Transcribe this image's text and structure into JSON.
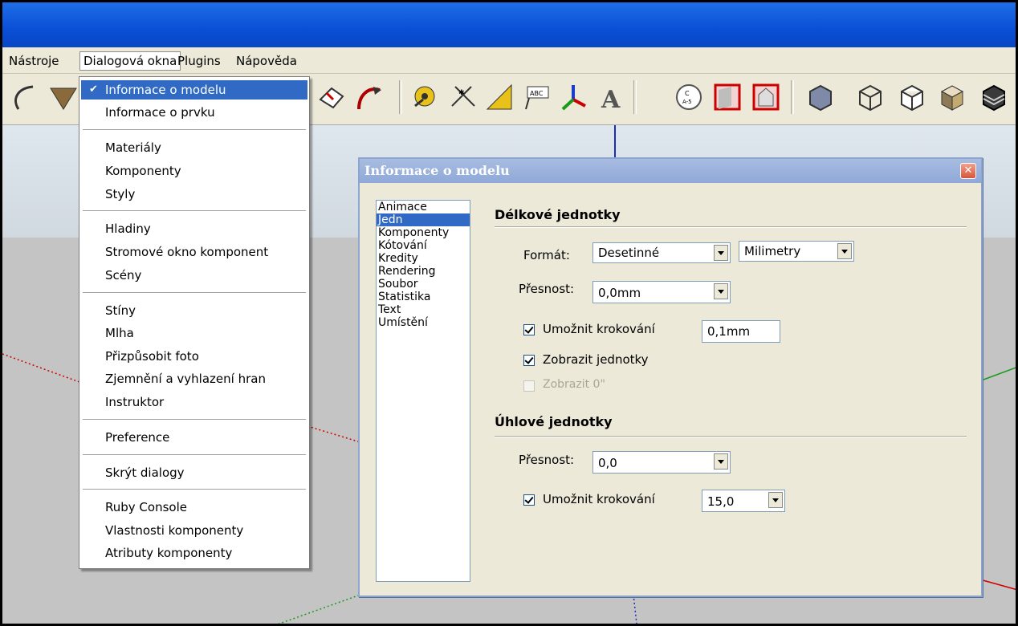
{
  "menubar": {
    "items": [
      "Nástroje",
      "Dialogová okna",
      "Plugins",
      "Nápověda"
    ]
  },
  "dropdown": {
    "items": [
      "Informace o modelu",
      "Informace o prvku",
      "Materiály",
      "Komponenty",
      "Styly",
      "Hladiny",
      "Stromové okno komponent",
      "Scény",
      "Stíny",
      "Mlha",
      "Přizpůsobit foto",
      "Zjemnění a vyhlazení hran",
      "Instruktor",
      "Preference",
      "Skrýt dialogy",
      "Ruby Console",
      "Vlastnosti komponenty",
      "Atributy komponenty"
    ],
    "checked_index": 0
  },
  "toolbar": {
    "icons": [
      "arc-icon",
      "paint-bucket-icon",
      "rotated-rectangle-icon",
      "follow-me-icon",
      "tape-measure-icon",
      "dimension-icon",
      "protractor-icon",
      "text-icon",
      "axes-icon",
      "3d-text-icon",
      "section-plane-icon",
      "section-display-icon",
      "section-cut-icon",
      "xray-icon",
      "wireframe-icon",
      "hidden-line-icon",
      "shaded-icon",
      "shaded-textures-icon"
    ]
  },
  "dialog": {
    "title": "Informace o modelu",
    "close_glyph": "✕",
    "nav": [
      "Animace",
      "Jedn",
      "Komponenty",
      "Kótování",
      "Kredity",
      "Rendering",
      "Soubor",
      "Statistika",
      "Text",
      "Umístění"
    ],
    "nav_selected_index": 1,
    "length": {
      "title": "Délkové jednotky",
      "format_label": "Formát:",
      "format_value": "Desetinné",
      "unit_value": "Milimetry",
      "precision_label": "Přesnost:",
      "precision_value": "0,0mm",
      "snap_label": "Umožnit krokování",
      "snap_checked": true,
      "snap_value": "0,1mm",
      "show_units_label": "Zobrazit jednotky",
      "show_units_checked": true,
      "show_zero_label": "Zobrazit 0\"",
      "show_zero_checked": false
    },
    "angle": {
      "title": "Úhlové jednotky",
      "precision_label": "Přesnost:",
      "precision_value": "0,0",
      "snap_label": "Umožnit krokování",
      "snap_checked": true,
      "snap_value": "15,0"
    }
  }
}
